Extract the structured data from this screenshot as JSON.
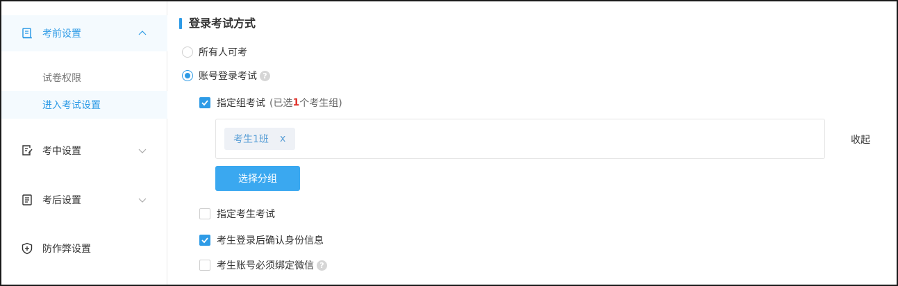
{
  "sidebar": {
    "groups": [
      {
        "label": "考前设置",
        "icon": "book-icon",
        "expanded": true
      },
      {
        "label": "考中设置",
        "icon": "edit-document-icon",
        "expanded": false
      },
      {
        "label": "考后设置",
        "icon": "score-report-icon",
        "expanded": false
      },
      {
        "label": "防作弊设置",
        "icon": "shield-plus-icon"
      }
    ],
    "subitems": [
      {
        "label": "试卷权限"
      },
      {
        "label": "进入考试设置",
        "active": true
      }
    ]
  },
  "main": {
    "section_title": "登录考试方式",
    "options": {
      "anyone": "所有人可考",
      "account_login": "账号登录考试"
    },
    "group_exam": {
      "label": "指定组考试",
      "note_prefix": "(已选",
      "count": "1",
      "note_suffix": "个考生组)"
    },
    "tags": [
      {
        "name": "考生1班",
        "remove": "x"
      }
    ],
    "collapse_label": "收起",
    "select_group_button": "选择分组",
    "checks": {
      "specific_student": "指定考生考试",
      "confirm_identity": "考生登录后确认身份信息",
      "bind_wechat": "考生账号必须绑定微信"
    },
    "help_glyph": "?"
  },
  "colors": {
    "accent": "#2e9be6",
    "button": "#3aa8f0",
    "count_red": "#e0322b",
    "active_bg": "#f4fafe"
  }
}
